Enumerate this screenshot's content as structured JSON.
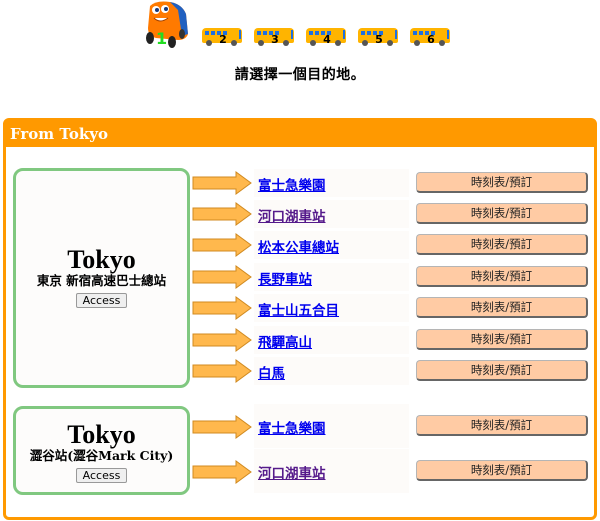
{
  "steps": {
    "current": "1",
    "buses": [
      "2",
      "3",
      "4",
      "5",
      "6"
    ]
  },
  "instruction": "請選擇一個目的地。",
  "panel": {
    "title": "From Tokyo",
    "colors": {
      "header": "#ff9900",
      "box_border": "#80c880",
      "button": "#ffcba4",
      "link": "#0000ee",
      "visited_link": "#551a8b"
    },
    "groups": [
      {
        "city": "Tokyo",
        "station": "東京 新宿高速巴士總站",
        "access_label": "Access",
        "routes": [
          {
            "destination": "富士急樂園",
            "button": "時刻表/預訂",
            "visited": false
          },
          {
            "destination": "河口湖車站",
            "button": "時刻表/預訂",
            "visited": true
          },
          {
            "destination": "松本公車總站",
            "button": "時刻表/預訂",
            "visited": false
          },
          {
            "destination": "長野車站",
            "button": "時刻表/預訂",
            "visited": false
          },
          {
            "destination": "富士山五合目",
            "button": "時刻表/預訂",
            "visited": false
          },
          {
            "destination": "飛驒高山",
            "button": "時刻表/預訂",
            "visited": false
          },
          {
            "destination": "白馬",
            "button": "時刻表/預訂",
            "visited": false
          }
        ]
      },
      {
        "city": "Tokyo",
        "station": "澀谷站(澀谷Mark City)",
        "access_label": "Access",
        "routes": [
          {
            "destination": "富士急樂園",
            "button": "時刻表/預訂",
            "visited": false
          },
          {
            "destination": "河口湖車站",
            "button": "時刻表/預訂",
            "visited": true
          }
        ]
      }
    ]
  }
}
